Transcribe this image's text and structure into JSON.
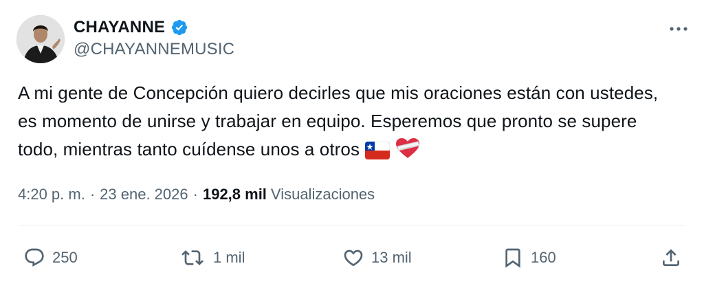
{
  "author": {
    "display_name": "CHAYANNE",
    "handle": "@CHAYANNEMUSIC",
    "avatar_icon": "profile-photo",
    "verified_icon": "verified-badge-icon",
    "verified_color": "#1d9bf0"
  },
  "tweet": {
    "text": "A mi gente de Concepción quiero decirles que mis oraciones están con ustedes, es momento de unirse y trabajar en equipo. Esperemos que pronto se supere todo, mientras tanto cuídense unos a otros",
    "emojis": [
      "chile-flag-icon",
      "bandaged-heart-icon"
    ]
  },
  "meta": {
    "time": "4:20 p. m.",
    "separator": "·",
    "date": "23 ene. 2026",
    "views_count": "192,8 mil",
    "views_label": "Visualizaciones"
  },
  "actions": {
    "reply_count": "250",
    "retweet_count": "1 mil",
    "like_count": "13 mil",
    "bookmark_count": "160"
  },
  "colors": {
    "text": "#0f1419",
    "secondary": "#536471",
    "divider": "#eff3f4"
  }
}
